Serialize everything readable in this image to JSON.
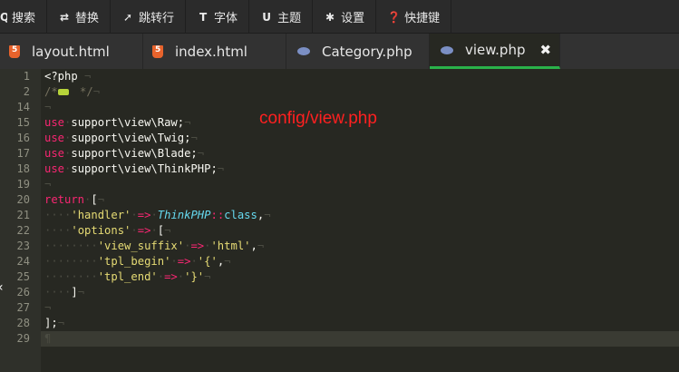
{
  "toolbar": {
    "items": [
      {
        "label": "搜索",
        "icon": "search-icon",
        "glyph": "Q"
      },
      {
        "label": "替换",
        "icon": "replace-icon",
        "glyph": "⇄"
      },
      {
        "label": "跳转行",
        "icon": "goto-line-icon",
        "glyph": "➚"
      },
      {
        "label": "字体",
        "icon": "font-icon",
        "glyph": "T"
      },
      {
        "label": "主题",
        "icon": "theme-icon",
        "glyph": "U"
      },
      {
        "label": "设置",
        "icon": "gear-icon",
        "glyph": "✱"
      },
      {
        "label": "快捷键",
        "icon": "help-icon",
        "glyph": "❓"
      }
    ]
  },
  "tabs": [
    {
      "label": "layout.html",
      "icon": "html5-icon"
    },
    {
      "label": "index.html",
      "icon": "html5-icon"
    },
    {
      "label": "Category.php",
      "icon": "php-icon"
    },
    {
      "label": "view.php",
      "icon": "php-icon",
      "active": true,
      "close": "✖"
    }
  ],
  "overlay_label": "config/view.php",
  "left_arrow": "‹",
  "lines": [
    {
      "n": "1",
      "code": "<?php"
    },
    {
      "n": "2",
      "code": "/*"
    },
    {
      "n": "14",
      "code": ""
    },
    {
      "n": "15",
      "code": "use support\\view\\Raw;"
    },
    {
      "n": "16",
      "code": "use support\\view\\Twig;"
    },
    {
      "n": "17",
      "code": "use support\\view\\Blade;"
    },
    {
      "n": "18",
      "code": "use support\\view\\ThinkPHP;"
    },
    {
      "n": "19",
      "code": ""
    },
    {
      "n": "20",
      "code": "return ["
    },
    {
      "n": "21",
      "code": "    'handler' => ThinkPHP::class,"
    },
    {
      "n": "22",
      "code": "    'options' => ["
    },
    {
      "n": "23",
      "code": "        'view_suffix' => 'html',"
    },
    {
      "n": "24",
      "code": "        'tpl_begin' => '{',"
    },
    {
      "n": "25",
      "code": "        'tpl_end' => '}'"
    },
    {
      "n": "26",
      "code": "    ]"
    },
    {
      "n": "27",
      "code": ""
    },
    {
      "n": "28",
      "code": "];"
    },
    {
      "n": "29",
      "code": ""
    }
  ],
  "colors": {
    "keyword": "#f92672",
    "string": "#e6db74",
    "class": "#66d9ef",
    "active_tab_underline": "#2ab24a",
    "overlay_label": "#ff2020"
  }
}
